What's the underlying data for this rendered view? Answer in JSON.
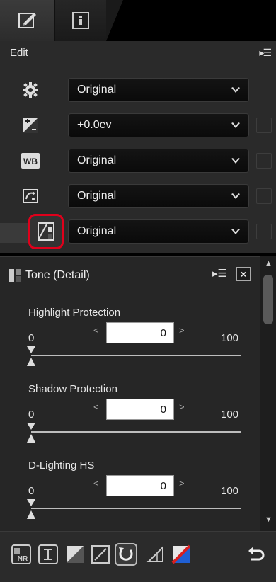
{
  "edit_panel": {
    "title": "Edit",
    "rows": [
      {
        "icon": "gear-icon",
        "value": "Original"
      },
      {
        "icon": "exposure-compensation-icon",
        "value": "+0.0ev"
      },
      {
        "icon": "white-balance-icon",
        "value": "Original"
      },
      {
        "icon": "picture-control-icon",
        "value": "Original"
      },
      {
        "icon": "tone-detail-icon",
        "value": "Original"
      }
    ],
    "wb_icon_text": "WB"
  },
  "tone_panel": {
    "title": "Tone (Detail)",
    "close_label": "×",
    "sliders": [
      {
        "label": "Highlight Protection",
        "min": "0",
        "max": "100",
        "value": "0"
      },
      {
        "label": "Shadow Protection",
        "min": "0",
        "max": "100",
        "value": "0"
      },
      {
        "label": "D-Lighting HS",
        "min": "0",
        "max": "100",
        "value": "0"
      }
    ],
    "decrement_glyph": "<",
    "increment_glyph": ">"
  },
  "toolbar": {
    "nr_icon_text": "NR"
  },
  "colors": {
    "highlight_outline": "#e0001b",
    "panel_bg": "#2a2a2a",
    "select_bg": "#0f0f0f"
  }
}
